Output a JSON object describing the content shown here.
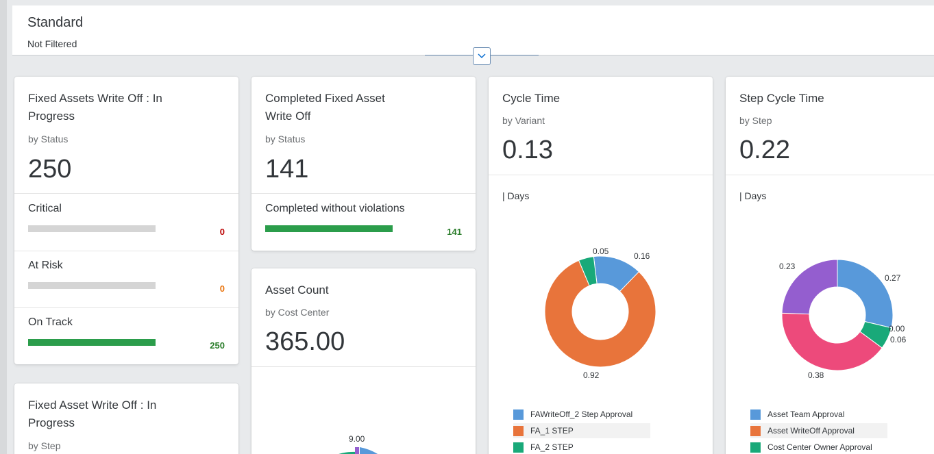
{
  "header": {
    "title": "Standard",
    "filter_status": "Not Filtered"
  },
  "cards": {
    "in_progress_status": {
      "title_line1": "Fixed Assets Write Off : In",
      "title_line2": "Progress",
      "subtitle": "by Status",
      "kpi": "250",
      "rows": [
        {
          "label": "Critical",
          "value": "0",
          "fill": 0,
          "color": "#bb0000"
        },
        {
          "label": "At Risk",
          "value": "0",
          "fill": 0,
          "color": "#e9730c"
        },
        {
          "label": "On Track",
          "value": "250",
          "fill": 1,
          "color": "#2b7d2b"
        }
      ]
    },
    "completed": {
      "title_line1": "Completed Fixed Asset",
      "title_line2": "Write Off",
      "subtitle": "by Status",
      "kpi": "141",
      "rows": [
        {
          "label": "Completed without violations",
          "value": "141",
          "fill": 1,
          "color": "#2b7d2b"
        }
      ]
    },
    "cycle_time": {
      "title": "Cycle Time",
      "subtitle": "by Variant",
      "kpi": "0.13",
      "unit": "| Days"
    },
    "step_cycle_time": {
      "title": "Step Cycle Time",
      "subtitle": "by Step",
      "kpi": "0.22",
      "unit": "| Days"
    },
    "asset_count": {
      "title": "Asset Count",
      "subtitle": "by Cost Center",
      "kpi": "365.00",
      "partial_label": "9.00"
    },
    "in_progress_step": {
      "title_line1": "Fixed Asset Write Off : In",
      "title_line2": "Progress",
      "subtitle": "by Step"
    }
  },
  "chart_data": [
    {
      "type": "pie",
      "title": "Cycle Time",
      "unit": "Days",
      "categories": [
        "FAWriteOff_2 Step Approval",
        "FA_1 STEP",
        "FA_2 STEP"
      ],
      "values": [
        0.16,
        0.92,
        0.05
      ],
      "labels": [
        "0.16",
        "0.92",
        "0.05"
      ],
      "colors": [
        "#5899da",
        "#e8743b",
        "#19a979"
      ]
    },
    {
      "type": "pie",
      "title": "Step Cycle Time",
      "unit": "Days",
      "categories": [
        "Asset Team Approval",
        "Asset WriteOff Approval",
        "Cost Center Owner Approval"
      ],
      "values": [
        0.27,
        0.0,
        0.06,
        0.38,
        0.23
      ],
      "labels": [
        "0.27",
        "0.00",
        "0.06",
        "0.38",
        "0.23"
      ],
      "colors": [
        "#5899da",
        "#e8743b",
        "#19a979",
        "#ed4a7b",
        "#945ecf"
      ]
    }
  ],
  "colors": {
    "accent": "#0a6ed1",
    "good": "#2b9d4b",
    "track": "#d5d5d5"
  }
}
